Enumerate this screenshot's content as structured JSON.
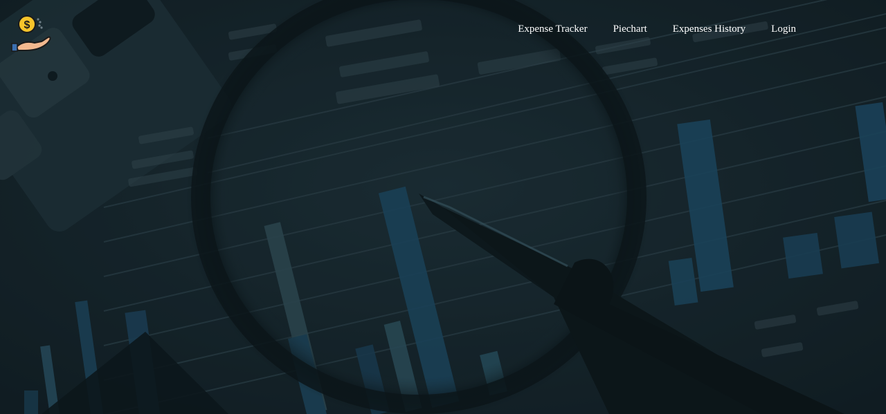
{
  "app": {
    "logo_icon": "dollar-coin-in-hand-icon"
  },
  "nav": {
    "items": [
      {
        "label": "Expense Tracker"
      },
      {
        "label": "Piechart"
      },
      {
        "label": "Expenses History"
      },
      {
        "label": "Login"
      }
    ]
  },
  "hero": {
    "background": "magnifier-over-financial-chart-image",
    "tint": "#16252d"
  },
  "colors": {
    "nav_text": "#ffffff",
    "logo_coin": "#f7c52b",
    "logo_hand": "#f3b98f",
    "logo_cuff": "#3b6fb0"
  }
}
